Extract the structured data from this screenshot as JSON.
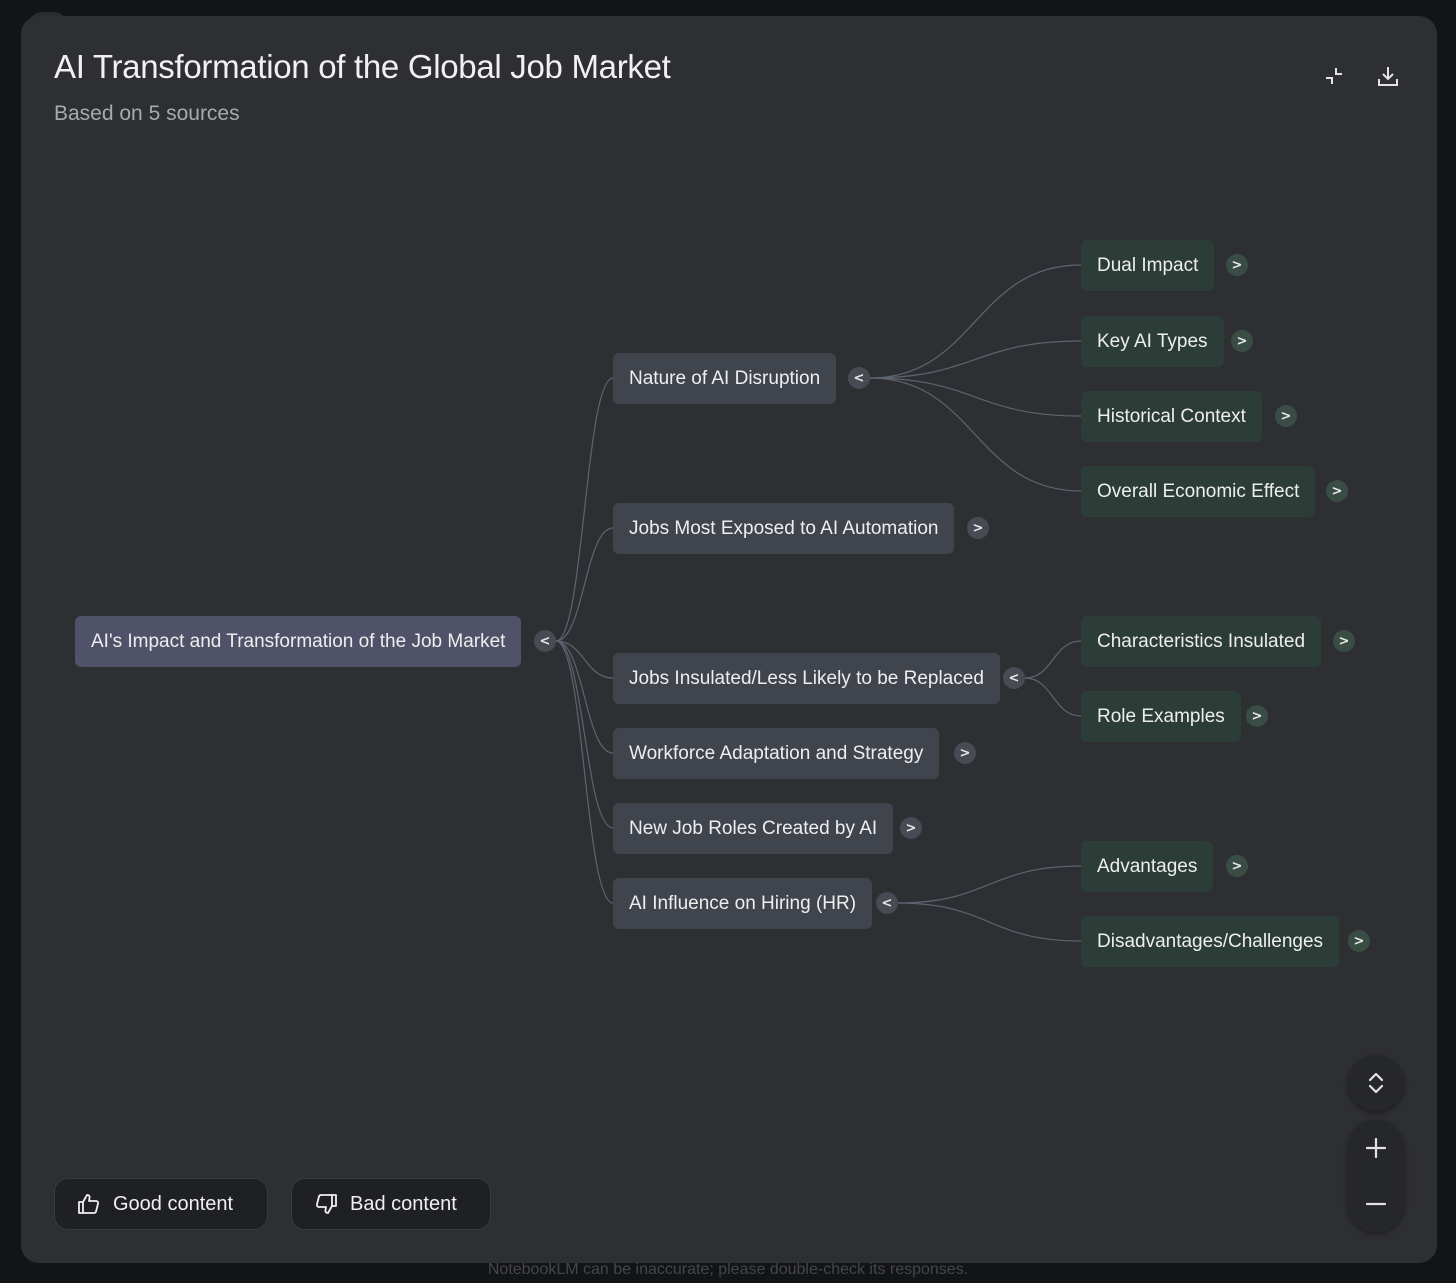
{
  "header": {
    "title": "AI Transformation of the Global Job Market",
    "subtitle": "Based on 5 sources",
    "collapse_icon": "collapse-icon",
    "download_icon": "download-icon"
  },
  "mindmap": {
    "root": {
      "label": "AI's Impact and Transformation of the Job Market",
      "toggle": "<"
    },
    "branches": [
      {
        "label": "Nature of AI Disruption",
        "toggle": "<"
      },
      {
        "label": "Jobs Most Exposed to AI Automation",
        "toggle": ">"
      },
      {
        "label": "Jobs Insulated/Less Likely to be Replaced",
        "toggle": "<"
      },
      {
        "label": "Workforce Adaptation and Strategy",
        "toggle": ">"
      },
      {
        "label": "New Job Roles Created by AI",
        "toggle": ">"
      },
      {
        "label": "AI Influence on Hiring (HR)",
        "toggle": "<"
      }
    ],
    "leaves": [
      {
        "label": "Dual Impact",
        "toggle": ">"
      },
      {
        "label": "Key AI Types",
        "toggle": ">"
      },
      {
        "label": "Historical Context",
        "toggle": ">"
      },
      {
        "label": "Overall Economic Effect",
        "toggle": ">"
      },
      {
        "label": "Characteristics Insulated",
        "toggle": ">"
      },
      {
        "label": "Role Examples",
        "toggle": ">"
      },
      {
        "label": "Advantages",
        "toggle": ">"
      },
      {
        "label": "Disadvantages/Challenges",
        "toggle": ">"
      }
    ]
  },
  "feedback": {
    "good_label": "Good content",
    "bad_label": "Bad content",
    "good_icon": "thumbs-up-icon",
    "bad_icon": "thumbs-down-icon"
  },
  "zoom_controls": {
    "expand_icon": "expand-collapse-icon",
    "zoom_in_icon": "plus-icon",
    "zoom_out_icon": "minus-icon"
  },
  "disclaimer": "NotebookLM can be inaccurate; please double-check its responses.",
  "colors": {
    "background": "#131416",
    "panel": "#2e2f33",
    "root_node": "#4f5269",
    "branch_node": "#3f444d",
    "leaf_node": "#2c3c36",
    "edge": "#5d6470"
  }
}
